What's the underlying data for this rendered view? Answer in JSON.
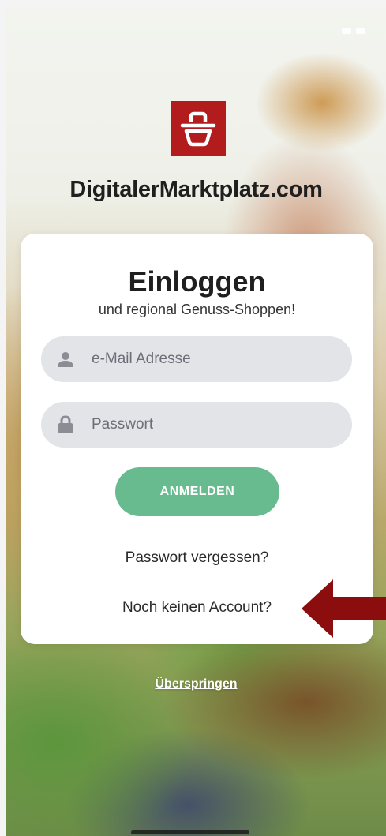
{
  "brand": {
    "name": "DigitalerMarktplatz.com",
    "logo_icon": "basket-icon",
    "logo_color": "#b21c1c"
  },
  "login": {
    "title": "Einloggen",
    "subtitle": "und regional Genuss-Shoppen!",
    "email_placeholder": "e-Mail Adresse",
    "email_value": "",
    "email_icon": "user-icon",
    "password_placeholder": "Passwort",
    "password_value": "",
    "password_icon": "lock-icon",
    "submit_label": "ANMELDEN",
    "submit_color": "#68bb8e",
    "forgot_link": "Passwort vergessen?",
    "register_link": "Noch keinen Account?"
  },
  "annotation": {
    "arrow_color": "#8b0d0d",
    "arrow_icon": "arrow-left-icon"
  },
  "skip_link": "Überspringen"
}
